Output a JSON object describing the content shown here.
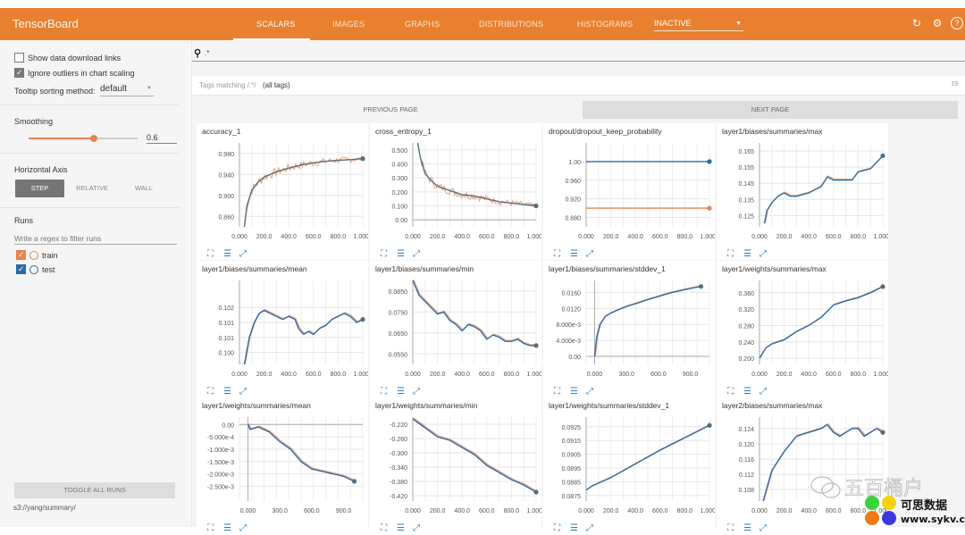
{
  "app": {
    "title": "TensorBoard"
  },
  "nav": {
    "tabs": [
      {
        "label": "SCALARS",
        "active": true
      },
      {
        "label": "IMAGES",
        "active": false
      },
      {
        "label": "GRAPHS",
        "active": false
      },
      {
        "label": "DISTRIBUTIONS",
        "active": false
      },
      {
        "label": "HISTOGRAMS",
        "active": false
      }
    ],
    "inactive_select": "INACTIVE",
    "icons": [
      "refresh-icon",
      "settings-icon",
      "help-icon"
    ]
  },
  "sidebar": {
    "show_download_links": {
      "label": "Show data download links",
      "checked": false
    },
    "ignore_outliers": {
      "label": "Ignore outliers in chart scaling",
      "checked": true
    },
    "tooltip_sorting": {
      "label": "Tooltip sorting method:",
      "value": "default"
    },
    "smoothing": {
      "label": "Smoothing",
      "value": "0.6",
      "fraction": 0.6
    },
    "horizontal_axis": {
      "label": "Horizontal Axis",
      "options": [
        "STEP",
        "RELATIVE",
        "WALL"
      ],
      "selected": "STEP"
    },
    "runs": {
      "label": "Runs",
      "filter_placeholder": "Write a regex to filter runs",
      "items": [
        {
          "name": "train",
          "checked": true,
          "color": "#e9824f"
        },
        {
          "name": "test",
          "checked": true,
          "color": "#2b6aa5"
        }
      ]
    },
    "toggle_all": "TOGGLE ALL RUNS",
    "logdir": "s3://yang/summary/"
  },
  "main": {
    "search_value": ".*",
    "tags_matching_prefix": "Tags matching /.*/",
    "tags_matching_suffix": "(all tags)",
    "tag_count": "19",
    "prev_page": "PREVIOUS PAGE",
    "next_page": "NEXT PAGE"
  },
  "colors": {
    "accent": "#e9802f",
    "train": "#e9824f",
    "test": "#2b6aa5",
    "smoothed": "#546e7a"
  },
  "chart_data": [
    {
      "type": "line",
      "title": "accuracy_1",
      "xticks": [
        "0.000",
        "200.0",
        "400.0",
        "600.0",
        "800.0",
        "1.000k"
      ],
      "xlim": [
        0,
        1000
      ],
      "yticks": [
        "0.860",
        "0.900",
        "0.940",
        "0.980"
      ],
      "ylim": [
        0.84,
        1.0
      ],
      "yvals": [
        0.86,
        0.9,
        0.94,
        0.98
      ],
      "noisy": true,
      "series": [
        {
          "name": "train",
          "x": [
            40,
            60,
            100,
            150,
            200,
            300,
            400,
            500,
            600,
            700,
            800,
            900,
            1000
          ],
          "y": [
            0.84,
            0.88,
            0.91,
            0.925,
            0.935,
            0.945,
            0.952,
            0.958,
            0.962,
            0.965,
            0.967,
            0.968,
            0.97
          ]
        }
      ]
    },
    {
      "type": "line",
      "title": "cross_entropy_1",
      "xticks": [
        "0.000",
        "200.0",
        "400.0",
        "600.0",
        "800.0",
        "1.000k"
      ],
      "xlim": [
        0,
        1000
      ],
      "yticks": [
        "0.00",
        "0.100",
        "0.200",
        "0.300",
        "0.400",
        "0.500"
      ],
      "ylim": [
        -0.05,
        0.55
      ],
      "yvals": [
        0,
        0.1,
        0.2,
        0.3,
        0.4,
        0.5
      ],
      "noisy": true,
      "series": [
        {
          "name": "train",
          "x": [
            40,
            60,
            100,
            150,
            200,
            300,
            400,
            500,
            600,
            700,
            800,
            900,
            1000
          ],
          "y": [
            0.55,
            0.45,
            0.33,
            0.28,
            0.24,
            0.21,
            0.18,
            0.17,
            0.15,
            0.13,
            0.12,
            0.11,
            0.1
          ]
        }
      ]
    },
    {
      "type": "line",
      "title": "dropout/dropout_keep_probability",
      "xticks": [
        "0.000",
        "200.0",
        "400.0",
        "600.0",
        "800.0",
        "1.000k"
      ],
      "xlim": [
        0,
        1000
      ],
      "yticks": [
        "0.880",
        "0.920",
        "0.960",
        "1.00"
      ],
      "ylim": [
        0.86,
        1.04
      ],
      "yvals": [
        0.88,
        0.92,
        0.96,
        1.0
      ],
      "series": [
        {
          "name": "test",
          "x": [
            0,
            1000
          ],
          "y": [
            1.0,
            1.0
          ]
        },
        {
          "name": "train",
          "x": [
            0,
            1000
          ],
          "y": [
            0.9,
            0.9
          ]
        }
      ]
    },
    {
      "type": "line",
      "title": "layer1/biases/summaries/max",
      "xticks": [
        "0.000",
        "200.0",
        "400.0",
        "600.0",
        "800.0",
        "1.000k"
      ],
      "xlim": [
        0,
        1000
      ],
      "yticks": [
        "0.125",
        "0.135",
        "0.145",
        "0.155",
        "0.165"
      ],
      "ylim": [
        0.118,
        0.17
      ],
      "yvals": [
        0.125,
        0.135,
        0.145,
        0.155,
        0.165
      ],
      "series": [
        {
          "name": "train",
          "x": [
            40,
            60,
            100,
            150,
            200,
            250,
            300,
            400,
            450,
            500,
            550,
            600,
            700,
            750,
            800,
            900,
            950,
            1000
          ],
          "y": [
            0.12,
            0.128,
            0.133,
            0.137,
            0.139,
            0.137,
            0.137,
            0.139,
            0.141,
            0.143,
            0.149,
            0.147,
            0.147,
            0.147,
            0.152,
            0.154,
            0.158,
            0.162
          ]
        }
      ]
    },
    {
      "type": "line",
      "title": "layer1/biases/summaries/mean",
      "xticks": [
        "0.000",
        "200.0",
        "400.0",
        "600.0",
        "800.0",
        "1.000k"
      ],
      "xlim": [
        0,
        1000
      ],
      "yticks": [
        "0.100",
        "0.101",
        "0.101",
        "0.102"
      ],
      "ylim": [
        0.0996,
        0.1024
      ],
      "yvals": [
        0.1,
        0.1005,
        0.101,
        0.1015
      ],
      "series": [
        {
          "name": "train",
          "x": [
            40,
            80,
            120,
            160,
            200,
            250,
            300,
            350,
            400,
            450,
            480,
            520,
            560,
            600,
            650,
            700,
            750,
            800,
            850,
            900,
            950,
            1000
          ],
          "y": [
            0.0996,
            0.1005,
            0.101,
            0.1013,
            0.1014,
            0.1013,
            0.1012,
            0.1011,
            0.1012,
            0.1011,
            0.1008,
            0.1006,
            0.1007,
            0.1006,
            0.1008,
            0.1009,
            0.1011,
            0.1012,
            0.1013,
            0.1012,
            0.101,
            0.1011
          ]
        }
      ]
    },
    {
      "type": "line",
      "title": "layer1/biases/summaries/min",
      "xticks": [
        "0.000",
        "200.0",
        "400.0",
        "600.0",
        "800.0",
        "1.000k"
      ],
      "xlim": [
        0,
        1000
      ],
      "yticks": [
        "0.0550",
        "0.0650",
        "0.0750",
        "0.0850"
      ],
      "ylim": [
        0.05,
        0.09
      ],
      "yvals": [
        0.055,
        0.065,
        0.075,
        0.085
      ],
      "series": [
        {
          "name": "train",
          "x": [
            0,
            50,
            100,
            150,
            200,
            250,
            300,
            350,
            400,
            450,
            500,
            550,
            600,
            650,
            700,
            750,
            800,
            850,
            900,
            950,
            1000
          ],
          "y": [
            0.09,
            0.083,
            0.08,
            0.077,
            0.074,
            0.075,
            0.071,
            0.069,
            0.066,
            0.069,
            0.068,
            0.066,
            0.062,
            0.064,
            0.063,
            0.061,
            0.061,
            0.062,
            0.06,
            0.059,
            0.059
          ]
        }
      ]
    },
    {
      "type": "line",
      "title": "layer1/biases/summaries/stddev_1",
      "xticks": [
        "0.000",
        "300.0",
        "600.0",
        "900.0"
      ],
      "xlim": [
        -80,
        1080
      ],
      "yticks": [
        "0.00",
        "4.000e-3",
        "8.000e-3",
        "0.0120",
        "0.0160"
      ],
      "ylim": [
        -0.002,
        0.019
      ],
      "yvals": [
        0,
        0.004,
        0.008,
        0.012,
        0.016
      ],
      "series": [
        {
          "name": "train",
          "x": [
            0,
            20,
            50,
            100,
            150,
            200,
            300,
            400,
            500,
            600,
            700,
            800,
            900,
            1000
          ],
          "y": [
            0,
            0.005,
            0.008,
            0.01,
            0.0108,
            0.0114,
            0.0125,
            0.0133,
            0.0142,
            0.015,
            0.0158,
            0.0164,
            0.017,
            0.0175
          ]
        }
      ]
    },
    {
      "type": "line",
      "title": "layer1/weights/summaries/max",
      "xticks": [
        "0.000",
        "200.0",
        "400.0",
        "600.0",
        "800.0",
        "1.000k"
      ],
      "xlim": [
        0,
        1000
      ],
      "yticks": [
        "0.200",
        "0.240",
        "0.280",
        "0.320",
        "0.360"
      ],
      "ylim": [
        0.185,
        0.39
      ],
      "yvals": [
        0.2,
        0.24,
        0.28,
        0.32,
        0.36
      ],
      "series": [
        {
          "name": "train",
          "x": [
            0,
            50,
            100,
            200,
            300,
            400,
            500,
            600,
            700,
            800,
            900,
            1000
          ],
          "y": [
            0.2,
            0.225,
            0.235,
            0.245,
            0.265,
            0.28,
            0.3,
            0.33,
            0.34,
            0.348,
            0.36,
            0.375
          ]
        }
      ]
    },
    {
      "type": "line",
      "title": "layer1/weights/summaries/mean",
      "xticks": [
        "0.000",
        "300.0",
        "600.0",
        "900.0"
      ],
      "xlim": [
        -80,
        1080
      ],
      "yticks": [
        "-2.500e-3",
        "-2.000e-3",
        "-1.500e-3",
        "-1.000e-3",
        "-5.000e-4",
        "0.00"
      ],
      "ylim": [
        -0.0031,
        0.0003
      ],
      "yvals": [
        -0.0025,
        -0.002,
        -0.0015,
        -0.001,
        -0.0005,
        0
      ],
      "series": [
        {
          "name": "train",
          "x": [
            0,
            20,
            100,
            200,
            300,
            400,
            500,
            600,
            700,
            800,
            900,
            1000
          ],
          "y": [
            0,
            -0.0002,
            -0.0001,
            -0.0003,
            -0.0007,
            -0.001,
            -0.0015,
            -0.0018,
            -0.0019,
            -0.002,
            -0.0021,
            -0.0023
          ]
        }
      ]
    },
    {
      "type": "line",
      "title": "layer1/weights/summaries/min",
      "xticks": [
        "0.000",
        "200.0",
        "400.0",
        "600.0",
        "800.0",
        "1.000k"
      ],
      "xlim": [
        0,
        1000
      ],
      "yticks": [
        "-0.420",
        "-0.380",
        "-0.340",
        "-0.300",
        "-0.260",
        "-0.220"
      ],
      "ylim": [
        -0.435,
        -0.2
      ],
      "yvals": [
        -0.42,
        -0.38,
        -0.34,
        -0.3,
        -0.26,
        -0.22
      ],
      "series": [
        {
          "name": "train",
          "x": [
            0,
            100,
            200,
            300,
            400,
            500,
            600,
            700,
            800,
            900,
            1000
          ],
          "y": [
            -0.205,
            -0.23,
            -0.255,
            -0.265,
            -0.285,
            -0.305,
            -0.335,
            -0.355,
            -0.375,
            -0.39,
            -0.41
          ]
        }
      ]
    },
    {
      "type": "line",
      "title": "layer1/weights/summaries/stddev_1",
      "xticks": [
        "0.000",
        "200.0",
        "400.0",
        "600.0",
        "800.0",
        "1.000k"
      ],
      "xlim": [
        0,
        1000
      ],
      "yticks": [
        "0.0875",
        "0.0885",
        "0.0895",
        "0.0905",
        "0.0915",
        "0.0925"
      ],
      "ylim": [
        0.0871,
        0.0932
      ],
      "yvals": [
        0.0875,
        0.0885,
        0.0895,
        0.0905,
        0.0915,
        0.0925
      ],
      "series": [
        {
          "name": "train",
          "x": [
            0,
            50,
            200,
            400,
            600,
            800,
            1000
          ],
          "y": [
            0.0879,
            0.0882,
            0.0888,
            0.0898,
            0.0908,
            0.0917,
            0.0926
          ]
        }
      ]
    },
    {
      "type": "line",
      "title": "layer2/biases/summaries/max",
      "xticks": [
        "0.000",
        "200.0",
        "400.0",
        "600.0",
        "800.0",
        "1.000k"
      ],
      "xlim": [
        0,
        1000
      ],
      "yticks": [
        "0.108",
        "0.112",
        "0.116",
        "0.120",
        "0.124"
      ],
      "ylim": [
        0.105,
        0.127
      ],
      "yvals": [
        0.108,
        0.112,
        0.116,
        0.12,
        0.124
      ],
      "series": [
        {
          "name": "train",
          "x": [
            30,
            100,
            200,
            300,
            400,
            500,
            550,
            600,
            650,
            700,
            750,
            800,
            850,
            900,
            950,
            1000
          ],
          "y": [
            0.105,
            0.113,
            0.118,
            0.122,
            0.123,
            0.124,
            0.125,
            0.123,
            0.122,
            0.123,
            0.124,
            0.124,
            0.122,
            0.123,
            0.124,
            0.123
          ]
        }
      ]
    }
  ]
}
